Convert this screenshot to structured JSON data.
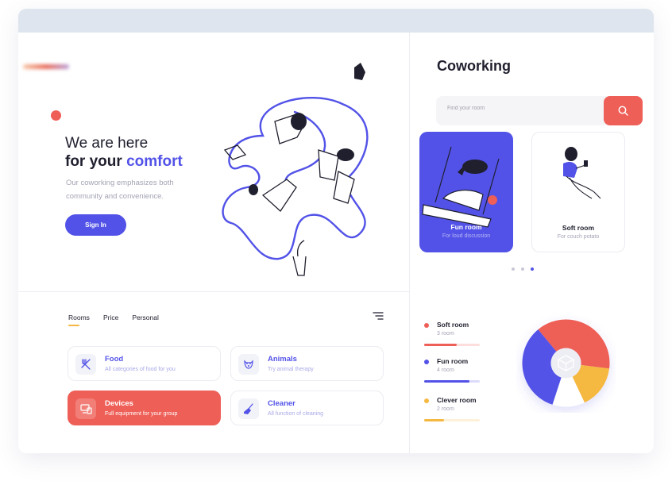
{
  "hero": {
    "title_line1": "We are here",
    "title_line2_prefix": "for your ",
    "title_line2_accent": "comfort",
    "subtitle": "Our coworking emphasizes both community and convenience.",
    "signin_label": "Sign In"
  },
  "tabs": [
    {
      "label": "Rooms",
      "active": true
    },
    {
      "label": "Price",
      "active": false
    },
    {
      "label": "Personal",
      "active": false
    }
  ],
  "categories": [
    {
      "title": "Food",
      "subtitle": "All categories of food for you",
      "icon": "fork-knife-icon",
      "active": false
    },
    {
      "title": "Animals",
      "subtitle": "Try animal therapy",
      "icon": "dog-icon",
      "active": false
    },
    {
      "title": "Devices",
      "subtitle": "Full equipment for your group",
      "icon": "devices-icon",
      "active": true
    },
    {
      "title": "Cleaner",
      "subtitle": "All function of cleaning",
      "icon": "broom-icon",
      "active": false
    }
  ],
  "coworking": {
    "title": "Coworking",
    "search_placeholder": "Find your room"
  },
  "rooms": [
    {
      "title": "Fun room",
      "subtitle": "For loud discussion"
    },
    {
      "title": "Soft room",
      "subtitle": "For couch potato"
    }
  ],
  "pagination": {
    "count": 3,
    "active_index": 2
  },
  "stats": [
    {
      "name": "Soft room",
      "count": "3 room",
      "color": "#ee5f57",
      "progress": 0.58
    },
    {
      "name": "Fun room",
      "count": "4 room",
      "color": "#5252e8",
      "progress": 0.82
    },
    {
      "name": "Clever room",
      "count": "2 room",
      "color": "#f5b841",
      "progress": 0.36
    }
  ],
  "donut": {
    "segments": [
      {
        "color": "#ee5f57",
        "share": 0.38
      },
      {
        "color": "#f5b841",
        "share": 0.16
      },
      {
        "color": "#ffffff",
        "share": 0.12
      },
      {
        "color": "#5252e8",
        "share": 0.34
      }
    ]
  },
  "colors": {
    "accent": "#5252e8",
    "red": "#ee5f57",
    "yellow": "#f5b841"
  }
}
